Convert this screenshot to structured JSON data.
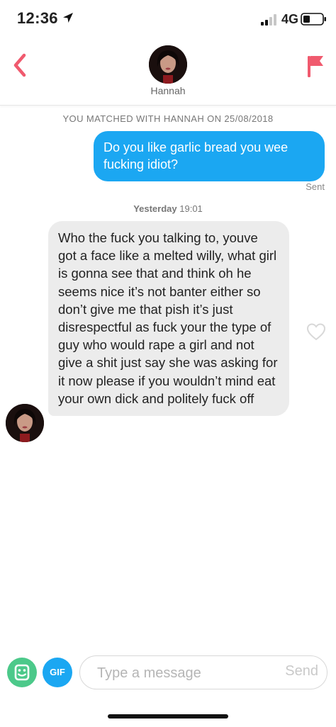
{
  "status_bar": {
    "time": "12:36",
    "network": "4G",
    "icons": [
      "location-arrow-icon",
      "signal-icon",
      "battery-icon"
    ]
  },
  "header": {
    "contact_name": "Hannah",
    "icons": [
      "chevron-left-icon",
      "flag-icon"
    ],
    "accent_color": "#f05a6e"
  },
  "conversation": {
    "matched_text": "YOU MATCHED WITH HANNAH ON 25/08/2018",
    "sent_message": "Do you like garlic bread you wee fucking idiot?",
    "sent_status": "Sent",
    "timestamp_day": "Yesterday",
    "timestamp_time": "19:01",
    "received_message": "Who the fuck you talking to, youve got a face like a melted willy, what girl is gonna see that and think oh he seems nice it’s not banter either so don’t give me that pish it’s just disrespectful as fuck your the type of guy who would rape a girl and not give a shit just say she was asking for it now please if you wouldn’t mind eat your own dick and politely fuck off",
    "sent_bubble_color": "#1ba7f2",
    "received_bubble_color": "#ececec"
  },
  "input_bar": {
    "gif_label": "GIF",
    "placeholder": "Type a message",
    "value": "",
    "send_label": "Send",
    "icons": [
      "sticker-icon",
      "gif-icon"
    ],
    "sticker_color": "#4cc98a",
    "gif_color": "#1ba7f2"
  }
}
